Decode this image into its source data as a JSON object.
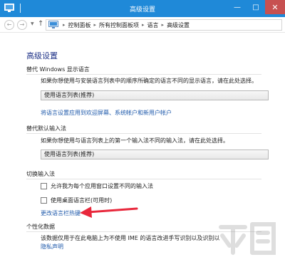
{
  "window": {
    "title": "高级设置"
  },
  "nav": {
    "breadcrumbs": [
      "控制面板",
      "所有控制面板项",
      "语言",
      "高级设置"
    ]
  },
  "page": {
    "title": "高级设置"
  },
  "sections": {
    "display_language": {
      "heading": "替代 Windows 显示语言",
      "description": "如果你想使用与安装语言列表中的顺序所确定的语言不同的显示语言，请在此处选择。",
      "select_value": "使用语言列表(推荐)",
      "link": "将语言设置应用到欢迎屏幕、系统帐户和新用户帐户"
    },
    "input_method": {
      "heading": "替代默认输入法",
      "description": "如果你想使用与语言列表上的第一个输入法不同的输入法，请在此处选择。",
      "select_value": "使用语言列表(推荐)"
    },
    "switch_input": {
      "heading": "切换输入法",
      "options": [
        {
          "label": "允许我为每个应用窗口设置不同的输入法",
          "checked": false
        },
        {
          "label": "使用桌面语言栏(可用时)",
          "checked": false
        }
      ],
      "link": "更改语言栏热键"
    },
    "personalization": {
      "heading": "个性化数据",
      "description": "该数据仅用于在此电脑上为不使用 IME 的语言改进手写识别以及识别以",
      "link": "隐私声明"
    }
  },
  "colors": {
    "titlebar": "#1f89d8",
    "heading": "#1e3287",
    "link": "#1f5aab",
    "arrow": "#e8283c"
  }
}
